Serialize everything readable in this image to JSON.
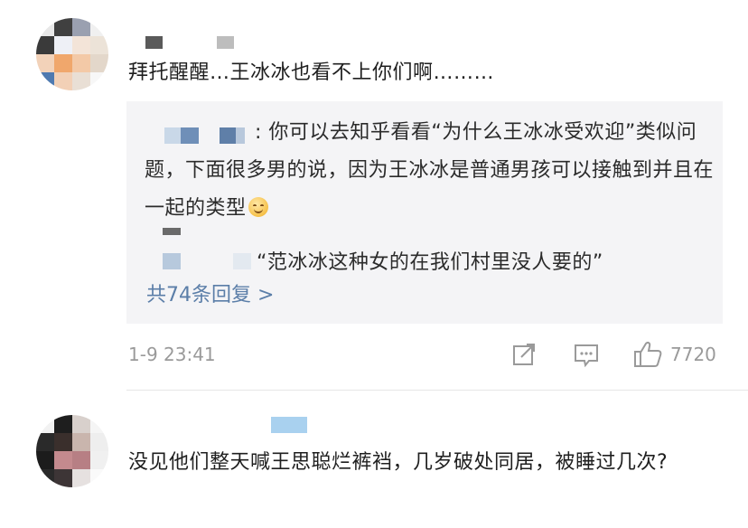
{
  "comment1": {
    "text": "拜托醒醒…王冰冰也看不上你们啊………",
    "reply_preview": {
      "first_reply_text_line1": ": 你可以去知乎看看“为什么王冰冰受欢",
      "first_reply_text_rest": "迎”类似问题，下面很多男的说，因为王冰冰是普通男孩可以接触到并且在一起的类型",
      "second_reply_text": "“范冰冰这种女的在我们村里没人要的”",
      "more_replies": "共74条回复 >"
    },
    "timestamp": "1-9 23:41",
    "like_count": "7720",
    "icons": [
      "share-icon",
      "comment-icon",
      "like-icon"
    ]
  },
  "comment2": {
    "text": "没见他们整天喊王思聪烂裤裆，几岁破处同居，被睡过几次?"
  },
  "colors": {
    "link": "#5b7ea8",
    "meta": "#9a9a9a",
    "reply_bg": "#f4f4f6"
  }
}
